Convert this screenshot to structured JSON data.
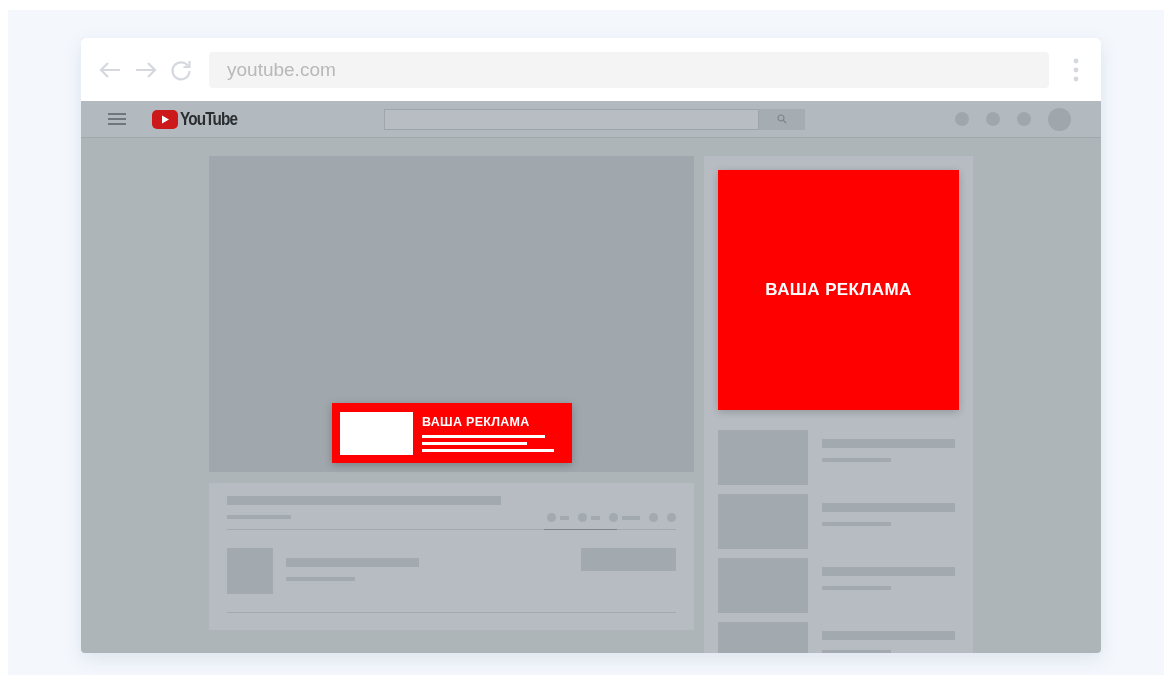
{
  "browser": {
    "address": "youtube.com"
  },
  "site_header": {
    "logo_text": "YouTube"
  },
  "video_overlay_ad": {
    "text": "ВАША РЕКЛАМА"
  },
  "sidebar_ad": {
    "text": "ВАША РЕКЛАМА"
  }
}
